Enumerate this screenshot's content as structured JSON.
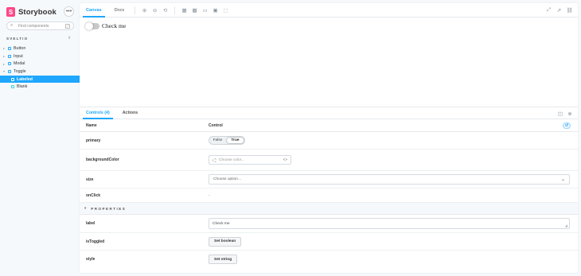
{
  "app": {
    "name": "Storybook",
    "logo_letter": "S",
    "accent": "#1ea7fd",
    "brand_color": "#ff4785"
  },
  "sidebar": {
    "menu_icon": "ellipsis-icon",
    "search_placeholder": "Find components",
    "search_shortcut": "/",
    "section_label": "SVELTIO",
    "items": [
      {
        "label": "Button",
        "type": "component"
      },
      {
        "label": "Input",
        "type": "component"
      },
      {
        "label": "Modal",
        "type": "component"
      },
      {
        "label": "Toggle",
        "type": "component",
        "expanded": true
      },
      {
        "label": "Labeled",
        "type": "story",
        "selected": true
      },
      {
        "label": "Blank",
        "type": "story"
      }
    ]
  },
  "toolbar": {
    "tabs": [
      "Canvas",
      "Docs"
    ],
    "active_tab": "Canvas",
    "tools": [
      "zoom-in-icon",
      "zoom-out-icon",
      "zoom-reset-icon",
      "background-icon",
      "grid-icon",
      "viewport-icon",
      "image-icon",
      "outline-icon"
    ],
    "right_tools": [
      "fullscreen-icon",
      "new-tab-icon",
      "copy-link-icon"
    ]
  },
  "canvas": {
    "toggle_label": "Check me",
    "toggled": false
  },
  "addons": {
    "tabs": [
      "Controls (4)",
      "Actions"
    ],
    "active_tab": "Controls (4)"
  },
  "controls": {
    "header_name": "Name",
    "header_control": "Control",
    "primary": {
      "name": "primary",
      "false_label": "False",
      "true_label": "True",
      "value": true
    },
    "backgroundColor": {
      "name": "backgroundColor",
      "placeholder": "Choose color...",
      "code_icon": "<>"
    },
    "size": {
      "name": "size",
      "placeholder": "Choose option..."
    },
    "onClick": {
      "name": "onClick",
      "value": "-"
    },
    "properties_label": "PROPERTIES",
    "label": {
      "name": "label",
      "value": "Check me"
    },
    "isToggled": {
      "name": "isToggled",
      "button": "Set boolean"
    },
    "style": {
      "name": "style",
      "button": "Set string"
    }
  }
}
